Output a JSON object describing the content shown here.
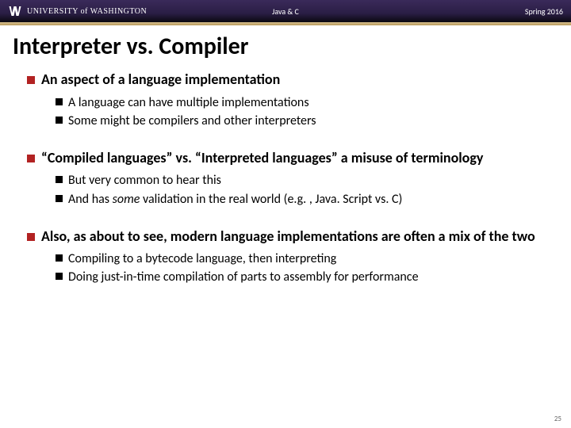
{
  "header": {
    "institution": "UNIVERSITY of WASHINGTON",
    "course": "Java & C",
    "term": "Spring 2016"
  },
  "title": "Interpreter vs. Compiler",
  "bullets": [
    {
      "text": "An aspect of a language implementation",
      "subs": [
        {
          "text": "A language can have multiple implementations"
        },
        {
          "text": "Some might be compilers and other interpreters"
        }
      ]
    },
    {
      "text": "“Compiled languages” vs. “Interpreted languages” a misuse of terminology",
      "subs": [
        {
          "text": "But very common to hear this"
        },
        {
          "prefix": "And has ",
          "em": "some",
          "suffix": " validation in the real world (e.g. , Java. Script vs. C)"
        }
      ]
    },
    {
      "text": "Also, as about to see, modern language implementations are often a mix of the two",
      "subs": [
        {
          "text": "Compiling to a bytecode language, then interpreting"
        },
        {
          "text": "Doing just-in-time compilation of parts to assembly for performance"
        }
      ]
    }
  ],
  "pagenum": "25"
}
